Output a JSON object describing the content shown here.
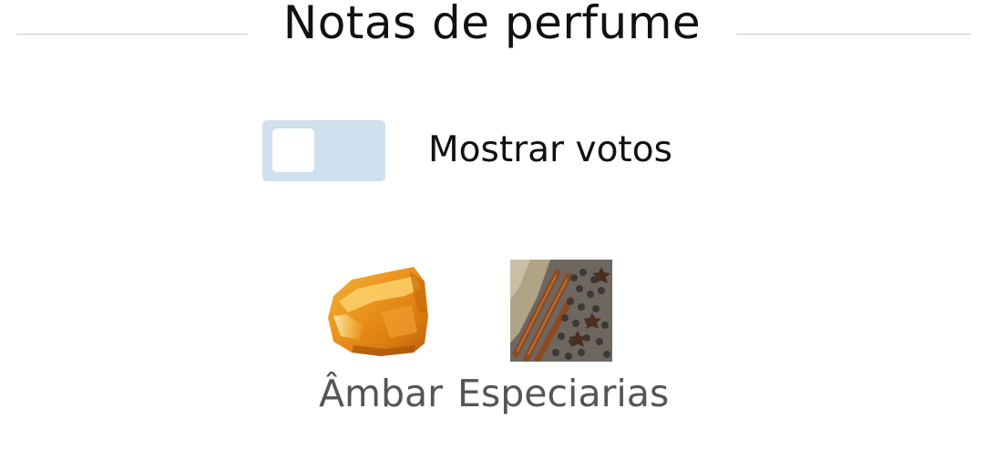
{
  "header": {
    "title": "Notas de perfume"
  },
  "votes_toggle": {
    "label": "Mostrar votos",
    "state": "off"
  },
  "notes": [
    {
      "name": "Âmbar",
      "icon": "amber-resin-image"
    },
    {
      "name": "Especiarias",
      "icon": "spices-image"
    }
  ],
  "colors": {
    "toggle_track": "#cfe0ee",
    "title_text": "#111111",
    "note_text": "#555555"
  }
}
